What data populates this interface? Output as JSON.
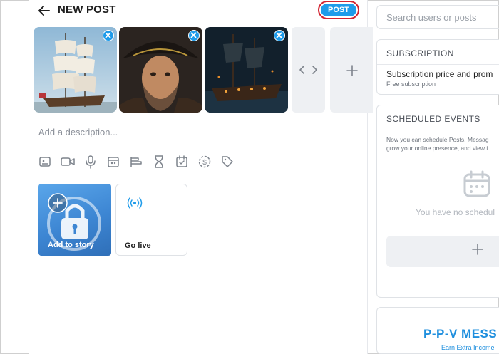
{
  "header": {
    "title": "NEW POST",
    "post_label": "POST"
  },
  "media": {
    "thumbnails": [
      {
        "subject": "sailing ship",
        "icon": "close-icon"
      },
      {
        "subject": "pirate captain",
        "icon": "close-icon"
      },
      {
        "subject": "ghost ship at night",
        "icon": "close-icon"
      }
    ]
  },
  "composer": {
    "description_placeholder": "Add a description...",
    "tools": [
      "image-icon",
      "video-icon",
      "microphone-icon",
      "vault-icon",
      "poll-icon",
      "hourglass-icon",
      "calendar-icon",
      "paid-icon",
      "tag-icon"
    ]
  },
  "story": {
    "add_label": "Add to story",
    "live_label": "Go live"
  },
  "sidebar": {
    "search_placeholder": "Search users or posts",
    "subscription": {
      "title": "SUBSCRIPTION",
      "line": "Subscription price and prom",
      "note": "Free subscription"
    },
    "scheduled": {
      "title": "SCHEDULED EVENTS",
      "desc_line1": "Now you can schedule Posts, Messag",
      "desc_line2": "grow your online presence, and view i",
      "empty": "You have no schedul"
    },
    "promo": {
      "title": "P-P-V MESS",
      "subtitle": "Earn Extra Income"
    }
  },
  "colors": {
    "accent": "#1e9bea",
    "highlight_ring": "#d32431",
    "panel_bg": "#eef0f3"
  }
}
